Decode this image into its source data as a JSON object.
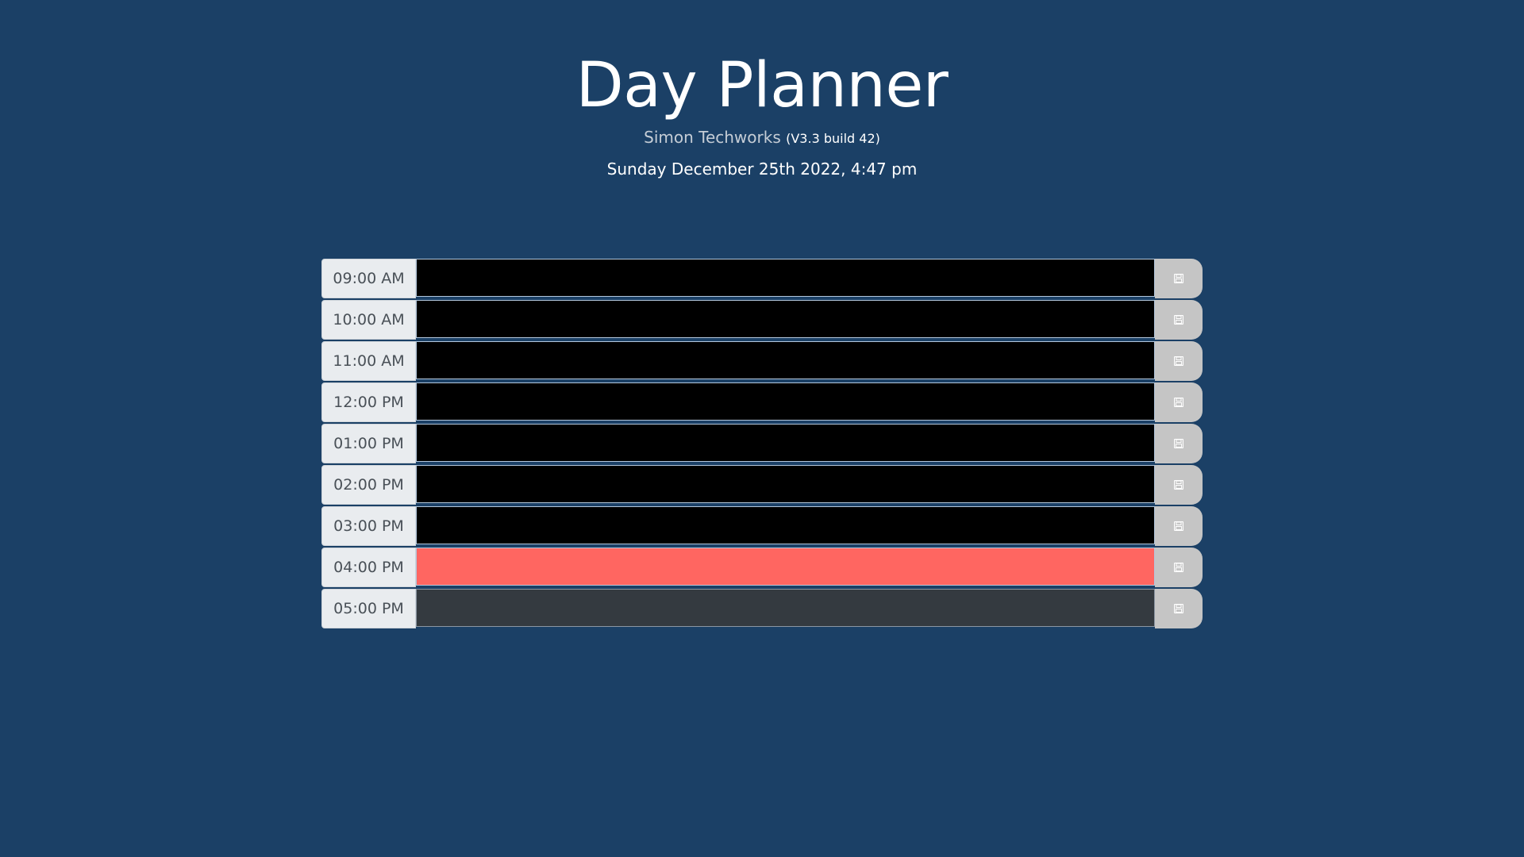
{
  "header": {
    "title": "Day Planner",
    "company": "Simon Techworks",
    "version": "(V3.3 build 42)",
    "current_date": "Sunday December 25th 2022, 4:47 pm"
  },
  "colors": {
    "background": "#1b4066",
    "past": "#000000",
    "present": "#ff6661",
    "future": "#343a40",
    "save_button": "#c5c5c5"
  },
  "rows": [
    {
      "hour": "09:00 AM",
      "description": "",
      "status": "past",
      "save_icon": "floppy-disk-icon"
    },
    {
      "hour": "10:00 AM",
      "description": "",
      "status": "past",
      "save_icon": "floppy-disk-icon"
    },
    {
      "hour": "11:00 AM",
      "description": "",
      "status": "past",
      "save_icon": "floppy-disk-icon"
    },
    {
      "hour": "12:00 PM",
      "description": "",
      "status": "past",
      "save_icon": "floppy-disk-icon"
    },
    {
      "hour": "01:00 PM",
      "description": "",
      "status": "past",
      "save_icon": "floppy-disk-icon"
    },
    {
      "hour": "02:00 PM",
      "description": "",
      "status": "past",
      "save_icon": "floppy-disk-icon"
    },
    {
      "hour": "03:00 PM",
      "description": "",
      "status": "past",
      "save_icon": "floppy-disk-icon"
    },
    {
      "hour": "04:00 PM",
      "description": "",
      "status": "present",
      "save_icon": "floppy-disk-icon"
    },
    {
      "hour": "05:00 PM",
      "description": "",
      "status": "future",
      "save_icon": "floppy-disk-icon"
    }
  ]
}
